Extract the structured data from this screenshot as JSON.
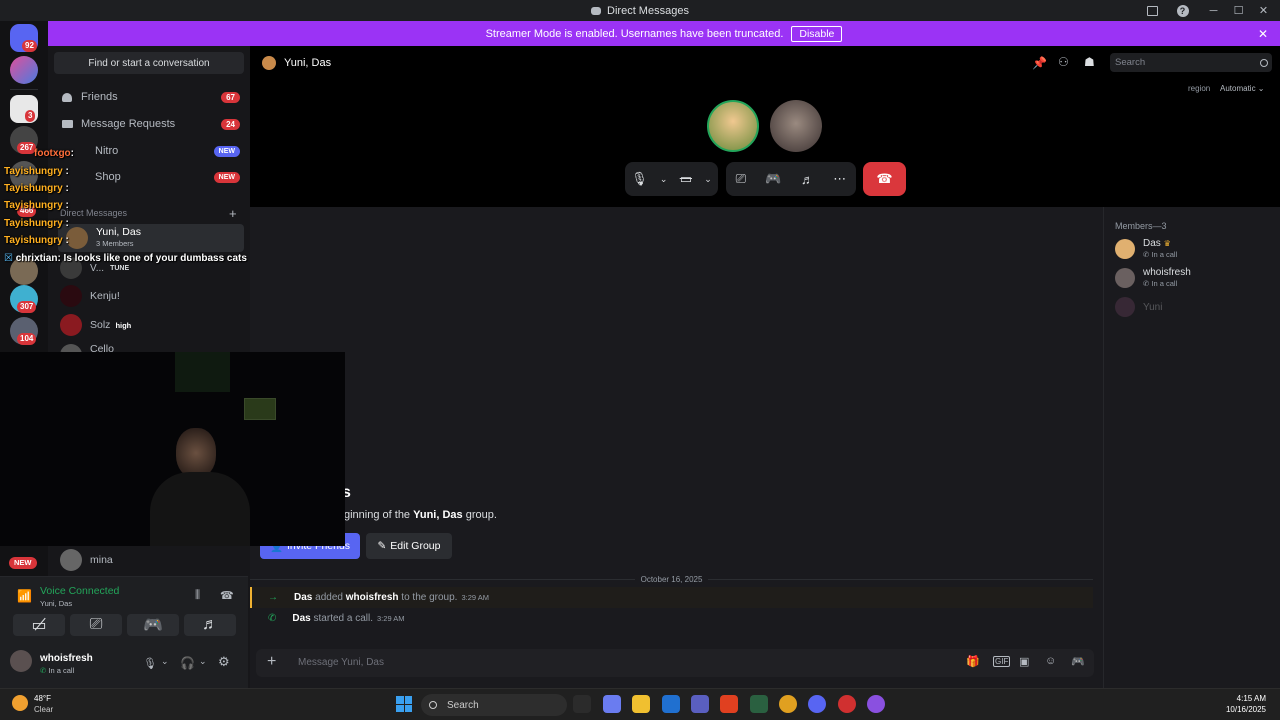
{
  "window": {
    "title": "Direct Messages"
  },
  "banner": {
    "text": "Streamer Mode is enabled. Usernames have been truncated.",
    "button": "Disable"
  },
  "rail": {
    "badges": [
      "92",
      "3",
      "267",
      "466",
      "307",
      "104",
      "NEW"
    ]
  },
  "sidebar": {
    "find": "Find or start a conversation",
    "nav": [
      {
        "label": "Friends",
        "count": "67",
        "icon": "friends-icon"
      },
      {
        "label": "Message Requests",
        "count": "24",
        "icon": "envelope-icon"
      },
      {
        "label": "Nitro",
        "tag": "NEW",
        "icon": "nitro-icon"
      },
      {
        "label": "Shop",
        "tag": "NEW",
        "icon": "shop-icon"
      }
    ],
    "dm_header": "Direct Messages",
    "dms": [
      {
        "name": "Yuni, Das",
        "sub": "3 Members"
      },
      {
        "name": "V...",
        "tag": "TUNE"
      },
      {
        "name": "Kenju!"
      },
      {
        "name": "Solz",
        "tag": "high"
      },
      {
        "name": "Cello"
      },
      {
        "name": "mina"
      }
    ]
  },
  "topbar": {
    "channel": "Yuni, Das",
    "search_placeholder": "Search",
    "region_label": "region",
    "region_value": "Automatic"
  },
  "members": {
    "header": "Members—3",
    "list": [
      {
        "name": "Das",
        "status": "In a call"
      },
      {
        "name": "whoisfresh",
        "status": "In a call"
      },
      {
        "name": "Yuni",
        "status": ""
      }
    ]
  },
  "chat": {
    "intro_title": "s",
    "intro_prefix": "ginning of the ",
    "intro_group": "Yuni, Das",
    "intro_suffix": " group.",
    "invite_btn": "Invite Friends",
    "edit_btn": "Edit Group",
    "date_divider": "October 16, 2025",
    "messages": [
      {
        "actor": "Das",
        "mid": " added ",
        "target": "whoisfresh",
        "end": " to the group.",
        "time": "3:29 AM"
      },
      {
        "actor": "Das",
        "mid": " started a call.",
        "target": "",
        "end": "",
        "time": "3:29 AM"
      }
    ],
    "input_placeholder": "Message Yuni, Das"
  },
  "overlay_chat": [
    {
      "user": "footxgo",
      "text": ":",
      "color": "#ff6d3a"
    },
    {
      "user": "Tayishungry",
      "text": ":",
      "color": "#ffb020"
    },
    {
      "user": "Tayishungry",
      "text": ":",
      "color": "#ffb020"
    },
    {
      "user": "Tayishungry",
      "text": ":",
      "color": "#ffb020"
    },
    {
      "user": "Tayishungry",
      "text": ":",
      "color": "#ffb020"
    },
    {
      "user": "Tayishungry",
      "text": ":",
      "color": "#ffb020"
    },
    {
      "user": "chrixtian",
      "text": ": Is looks like one of your dumbass cats",
      "color": "#ffffff"
    }
  ],
  "voice": {
    "status": "Voice Connected",
    "channel": "Yuni, Das"
  },
  "user": {
    "name": "whoisfresh",
    "status": "In a call"
  },
  "taskbar": {
    "weather_temp": "48°F",
    "weather_desc": "Clear",
    "search": "Search",
    "time": "4:15 AM",
    "date": "10/16/2025"
  },
  "colors": {
    "accent": "#5865f2",
    "banner": "#9b33f5",
    "danger": "#da373c",
    "green": "#23a55a"
  }
}
